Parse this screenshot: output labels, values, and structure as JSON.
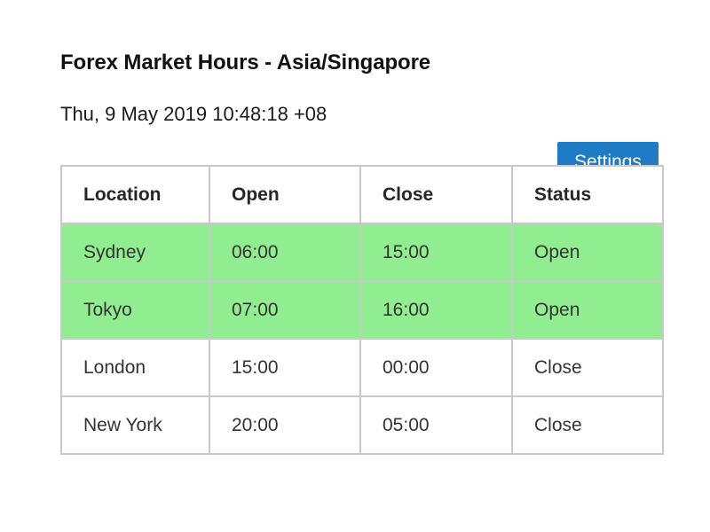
{
  "header": {
    "title": "Forex Market Hours - Asia/Singapore",
    "timestamp": "Thu, 9 May 2019 10:48:18 +08",
    "settings_label": "Settings"
  },
  "colors": {
    "button_blue": "#1f7cc4",
    "row_open_green": "#90ee90",
    "row_close_white": "#ffffff",
    "border_gray": "#c9c9c9",
    "text_dark": "#333333"
  },
  "table": {
    "columns": [
      "Location",
      "Open",
      "Close",
      "Status"
    ],
    "rows": [
      {
        "location": "Sydney",
        "open": "06:00",
        "close": "15:00",
        "status": "Open",
        "state": "open"
      },
      {
        "location": "Tokyo",
        "open": "07:00",
        "close": "16:00",
        "status": "Open",
        "state": "open"
      },
      {
        "location": "London",
        "open": "15:00",
        "close": "00:00",
        "status": "Close",
        "state": "close"
      },
      {
        "location": "New York",
        "open": "20:00",
        "close": "05:00",
        "status": "Close",
        "state": "close"
      }
    ]
  }
}
